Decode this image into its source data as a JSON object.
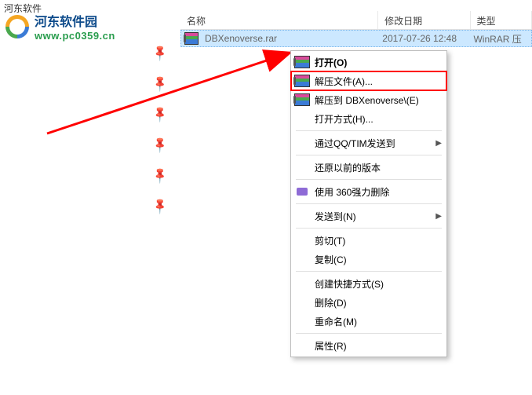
{
  "titlebar": "河东软件",
  "watermark": {
    "title": "河东软件园",
    "url": "www.pc0359.cn"
  },
  "columns": {
    "name": "名称",
    "date": "修改日期",
    "type": "类型"
  },
  "file": {
    "name": "DBXenoverse.rar",
    "date": "2017-07-26 12:48",
    "type": "WinRAR 压"
  },
  "menu": {
    "open": "打开(O)",
    "extract_files": "解压文件(A)...",
    "extract_to": "解压到 DBXenoverse\\(E)",
    "open_with": "打开方式(H)...",
    "send_qq": "通过QQ/TIM发送到",
    "restore": "还原以前的版本",
    "force_delete": "使用 360强力删除",
    "send_to": "发送到(N)",
    "cut": "剪切(T)",
    "copy": "复制(C)",
    "shortcut": "创建快捷方式(S)",
    "delete": "删除(D)",
    "rename": "重命名(M)",
    "properties": "属性(R)"
  }
}
